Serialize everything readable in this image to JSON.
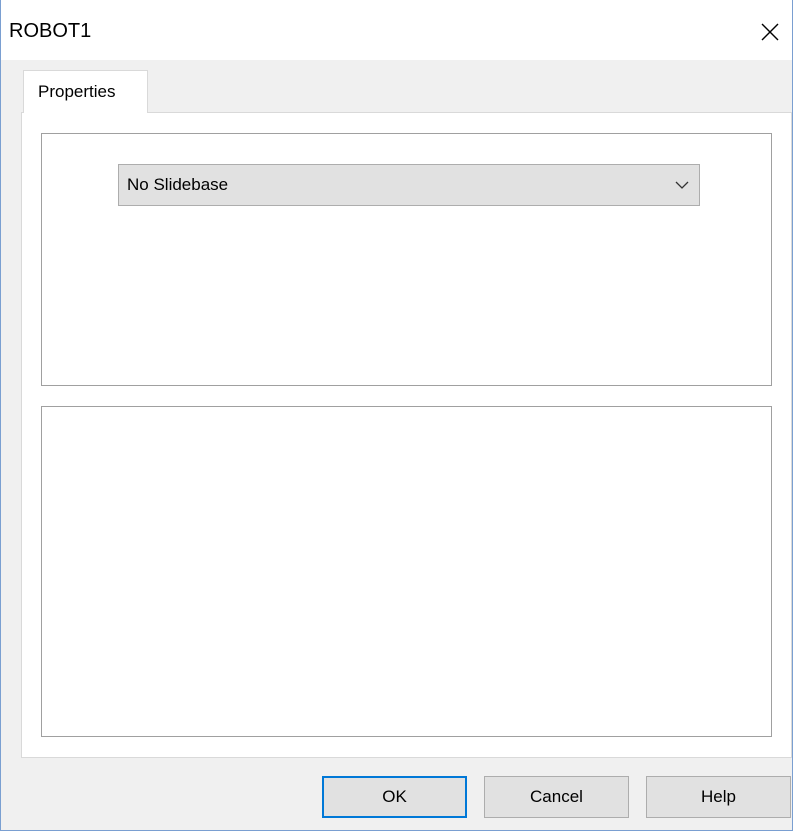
{
  "window": {
    "title": "ROBOT1",
    "close_icon": "close-icon",
    "accent_color": "#0078d7"
  },
  "tabs": [
    {
      "label": "Properties",
      "selected": true
    }
  ],
  "slidebase_combo": {
    "value": "No Slidebase",
    "arrow_icon": "chevron-down-icon"
  },
  "buttons": {
    "ok": "OK",
    "cancel": "Cancel",
    "help": "Help"
  }
}
